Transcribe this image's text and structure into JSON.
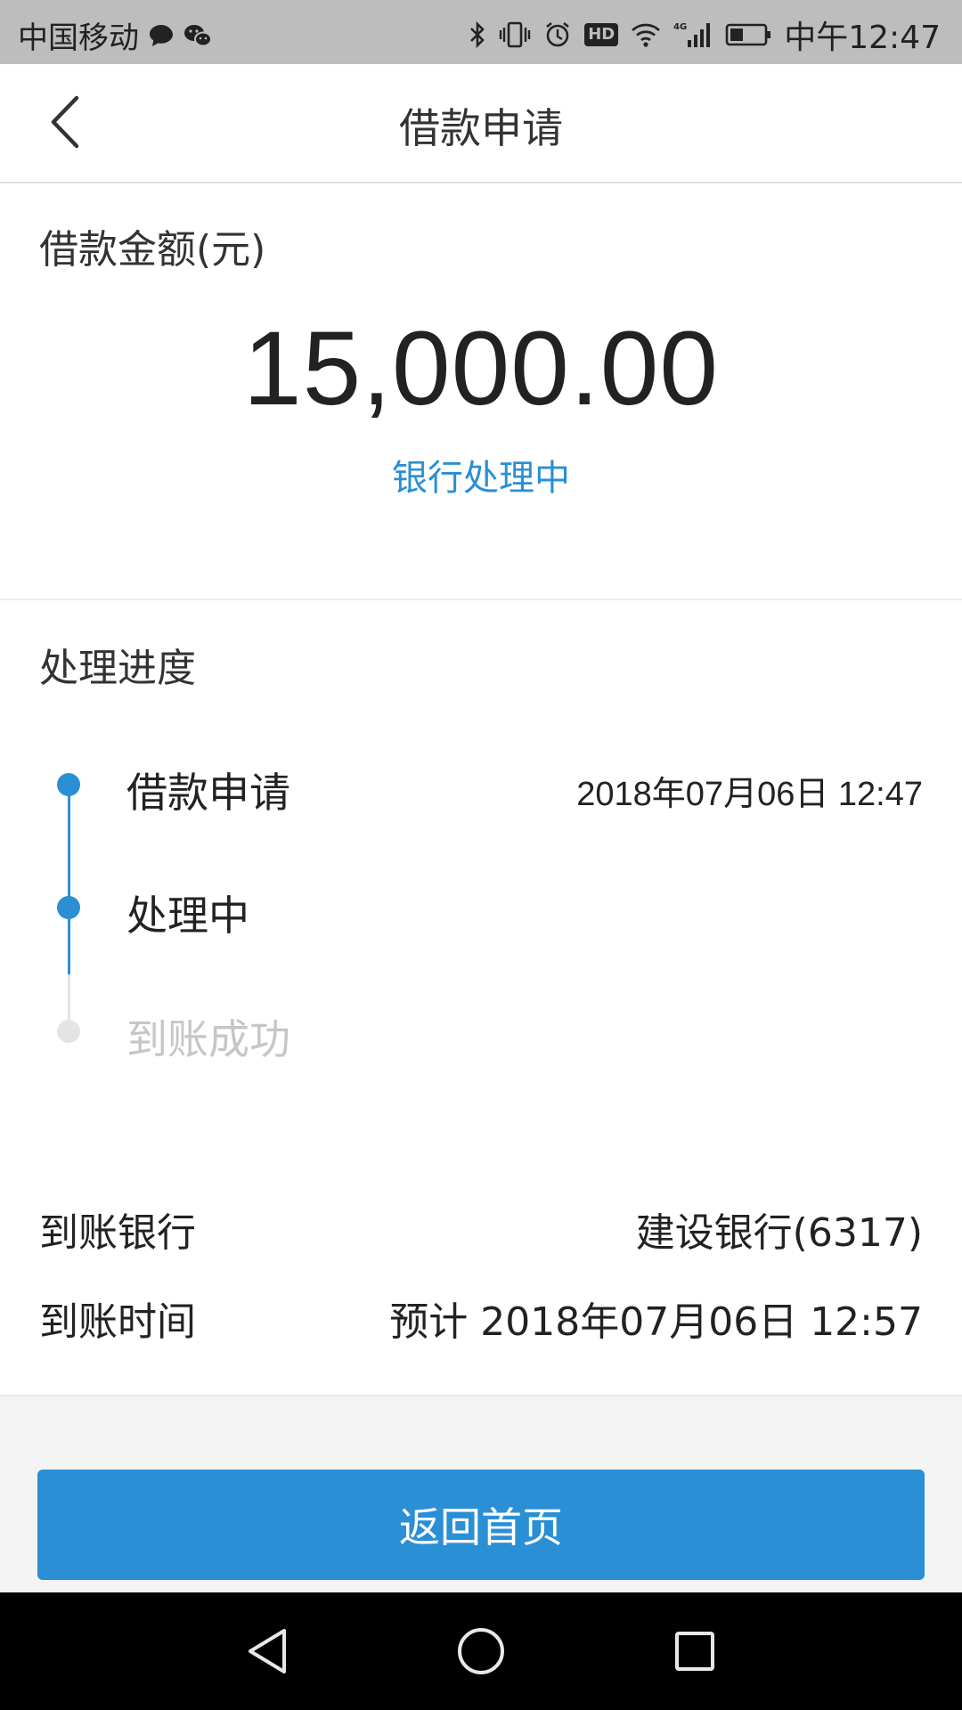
{
  "status_bar": {
    "carrier": "中国移动",
    "icons_left": [
      "message-icon",
      "wechat-icon"
    ],
    "icons_right": [
      "bluetooth-icon",
      "vibrate-icon",
      "alarm-icon",
      "hd-icon",
      "wifi-icon",
      "signal-4g-icon",
      "battery-icon"
    ],
    "hd_label": "HD",
    "time": "中午12:47"
  },
  "header": {
    "title": "借款申请",
    "back_icon": "back-arrow-icon"
  },
  "amount": {
    "label": "借款金额(元)",
    "value": "15,000.00",
    "status": "银行处理中",
    "status_color": "#2a8fd4"
  },
  "progress": {
    "title": "处理进度",
    "steps": [
      {
        "label": "借款申请",
        "time": "2018年07月06日 12:47",
        "state": "done"
      },
      {
        "label": "处理中",
        "time": "",
        "state": "done"
      },
      {
        "label": "到账成功",
        "time": "",
        "state": "pending"
      }
    ],
    "info": [
      {
        "label": "到账银行",
        "value": "建设银行(6317)"
      },
      {
        "label": "到账时间",
        "value": "预计 2018年07月06日 12:57"
      }
    ]
  },
  "actions": {
    "home_button": "返回首页",
    "accent_color": "#2a8fd4"
  },
  "nav_bar": {
    "icons": [
      "nav-back-icon",
      "nav-home-icon",
      "nav-recents-icon"
    ]
  }
}
